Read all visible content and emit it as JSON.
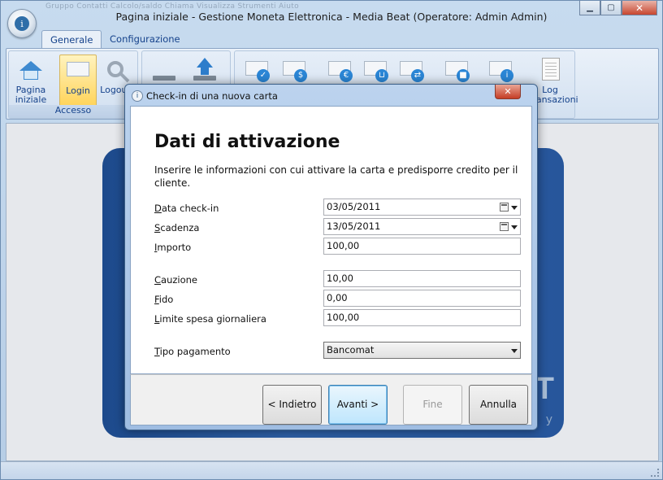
{
  "window": {
    "title": "Pagina iniziale - Gestione Moneta Elettronica - Media Beat (Operatore: Admin Admin)",
    "qat_text": "Gruppo   Contatti   Calcolo/saldo   Chiama   Visualizza   Strumenti   Aiuto",
    "minimize": "▁",
    "maximize": "▢",
    "close": "✕"
  },
  "tabs": [
    {
      "label": "Generale"
    },
    {
      "label": "Configurazione"
    }
  ],
  "ribbon": {
    "group_accesso": "Accesso",
    "btn_home": "Pagina iniziale",
    "btn_login": "Login",
    "btn_logout": "Logout",
    "btn_log": "Log transazioni"
  },
  "background": {
    "mark": "T",
    "mark_small": "y"
  },
  "dialog": {
    "title": "Check-in di una nuova carta",
    "heading": "Dati di attivazione",
    "description": "Inserire le informazioni con cui attivare la carta e predisporre credito per il cliente.",
    "fields": {
      "data_checkin": {
        "label_u": "D",
        "label_rest": "ata check-in",
        "value": "03/05/2011"
      },
      "scadenza": {
        "label_u": "S",
        "label_rest": "cadenza",
        "value": "13/05/2011"
      },
      "importo": {
        "label_u": "I",
        "label_rest": "mporto",
        "value": "100,00"
      },
      "cauzione": {
        "label_u": "C",
        "label_rest": "auzione",
        "value": "10,00"
      },
      "fido": {
        "label_u": "F",
        "label_rest": "ido",
        "value": "0,00"
      },
      "limite": {
        "label_u": "L",
        "label_rest": "imite spesa giornaliera",
        "value": "100,00"
      },
      "tipo_pagamento": {
        "label_u": "T",
        "label_rest": "ipo pagamento",
        "value": "Bancomat"
      }
    },
    "buttons": {
      "back": "< Indietro",
      "next": "Avanti >",
      "finish": "Fine",
      "cancel": "Annulla"
    }
  }
}
